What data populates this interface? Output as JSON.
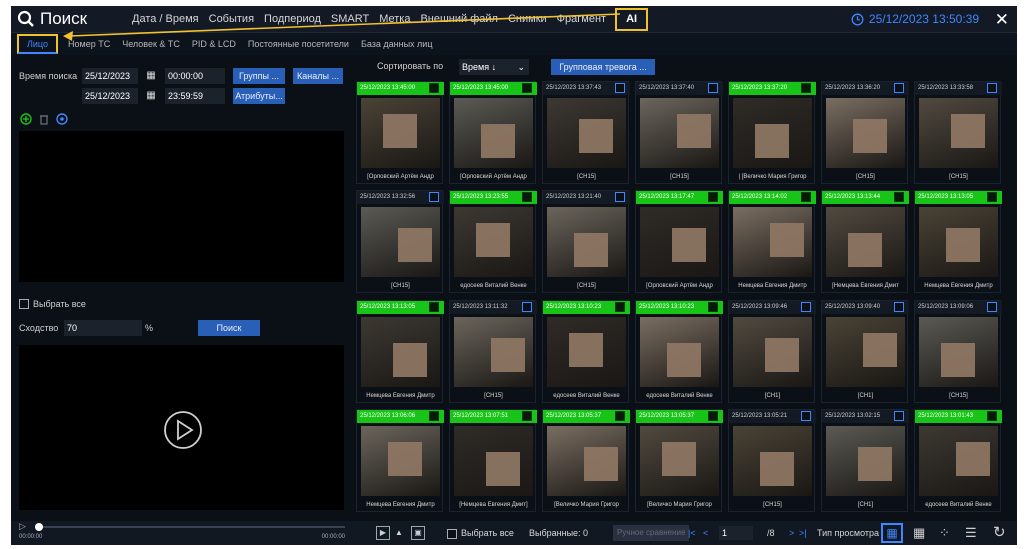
{
  "header": {
    "title": "Поиск",
    "menu": [
      "Дата / Время",
      "События",
      "Подпериод",
      "SMART",
      "Метка",
      "Внешний файл",
      "Снимки",
      "Фрагмент",
      "AI"
    ],
    "active_menu": "AI",
    "datetime": "25/12/2023 13:50:39"
  },
  "subtabs": [
    "Лицо",
    "Номер ТС",
    "Человек & ТС",
    "PID & LCD",
    "Постоянные посетители",
    "База данных лиц"
  ],
  "search": {
    "time_label": "Время поиска",
    "start_date": "25/12/2023",
    "start_time": "00:00:00",
    "end_date": "25/12/2023",
    "end_time": "23:59:59",
    "groups_btn": "Группы ...",
    "channels_btn": "Каналы ...",
    "attributes_btn": "Атрибуты...",
    "select_all": "Выбрать все",
    "similarity_label": "Сходство",
    "similarity_value": "70",
    "percent": "%",
    "search_btn": "Поиск"
  },
  "player": {
    "time_start": "00:00:00",
    "time_end": "00:00:00",
    "progress": 0
  },
  "sort": {
    "label": "Сортировать по",
    "value": "Время ↓",
    "group_alarm_btn": "Групповая тревога ..."
  },
  "results": [
    [
      {
        "time": "25/12/2023 13:45:00",
        "caption": "[Орловский Артём Андр",
        "selected": true
      },
      {
        "time": "25/12/2023 13:45:00",
        "caption": "[Орловский Артём Андр",
        "selected": true
      },
      {
        "time": "25/12/2023 13:37:43",
        "caption": "[CH15]",
        "selected": false
      },
      {
        "time": "25/12/2023 13:37:40",
        "caption": "[CH15]",
        "selected": false
      },
      {
        "time": "25/12/2023 13:37:20",
        "caption": "| [Величко Мария Григор",
        "selected": true
      },
      {
        "time": "25/12/2023 13:36:20",
        "caption": "[CH15]",
        "selected": false
      },
      {
        "time": "25/12/2023 13:33:58",
        "caption": "[CH15]",
        "selected": false
      }
    ],
    [
      {
        "time": "25/12/2023 13:32:56",
        "caption": "[CH15]",
        "selected": false
      },
      {
        "time": "25/12/2023 13:23:55",
        "caption": "едосеев Виталий Венке",
        "selected": true
      },
      {
        "time": "25/12/2023 13:21:40",
        "caption": "[CH15]",
        "selected": false
      },
      {
        "time": "25/12/2023 13:17:47",
        "caption": "[Орловский Артём Андр",
        "selected": true
      },
      {
        "time": "25/12/2023 13:14:02",
        "caption": "Немцева Евгения Дмитр",
        "selected": true
      },
      {
        "time": "25/12/2023 13:13:44",
        "caption": "[Немцева Евгения Дмит",
        "selected": true
      },
      {
        "time": "25/12/2023 13:13:05",
        "caption": "Немцева Евгения Дмитр",
        "selected": true
      }
    ],
    [
      {
        "time": "25/12/2023 13:13:05",
        "caption": "Немцева Евгения Дмитр",
        "selected": true
      },
      {
        "time": "25/12/2023 13:11:32",
        "caption": "[CH15]",
        "selected": false
      },
      {
        "time": "25/12/2023 13:10:23",
        "caption": "едосеев Виталий Венке",
        "selected": true
      },
      {
        "time": "25/12/2023 13:10:23",
        "caption": "едосеев Виталий Венке",
        "selected": true
      },
      {
        "time": "25/12/2023 13:09:46",
        "caption": "[CH1]",
        "selected": false
      },
      {
        "time": "25/12/2023 13:09:40",
        "caption": "[CH1]",
        "selected": false
      },
      {
        "time": "25/12/2023 13:09:06",
        "caption": "[CH15]",
        "selected": false
      }
    ],
    [
      {
        "time": "25/12/2023 13:06:06",
        "caption": "Немцева Евгения Дмитр",
        "selected": true
      },
      {
        "time": "25/12/2023 13:07:51",
        "caption": "[Немцева Евгения Дмит]",
        "selected": true
      },
      {
        "time": "25/12/2023 13:05:37",
        "caption": "[Величко Мария Григор",
        "selected": true
      },
      {
        "time": "25/12/2023 13:05:37",
        "caption": "[Величко Мария Григор",
        "selected": true
      },
      {
        "time": "25/12/2023 13:05:21",
        "caption": "[CH15]",
        "selected": false
      },
      {
        "time": "25/12/2023 13:02:15",
        "caption": "[CH1]",
        "selected": false
      },
      {
        "time": "25/12/2023 13:01:43",
        "caption": "едосеев Виталий Венке",
        "selected": true
      }
    ]
  ],
  "bottom": {
    "select_all": "Выбрать все",
    "selected_label": "Выбранные: 0",
    "manual_compare": "Ручное сравнение",
    "page_current": "1",
    "page_total": "/8",
    "view_type_label": "Тип просмотра"
  },
  "colors": {
    "accent": "#3f86ff",
    "annotation": "#f2c12e",
    "selected": "#17c417",
    "button": "#2a5fb8"
  },
  "icons": [
    "search-icon",
    "clock-icon",
    "close-icon",
    "calendar-icon",
    "add-icon",
    "delete-icon",
    "settings-icon",
    "play-icon",
    "export-icon",
    "save-icon",
    "first-page-icon",
    "prev-page-icon",
    "next-page-icon",
    "last-page-icon",
    "grid-view-icon",
    "list-view-icon",
    "refresh-icon"
  ]
}
